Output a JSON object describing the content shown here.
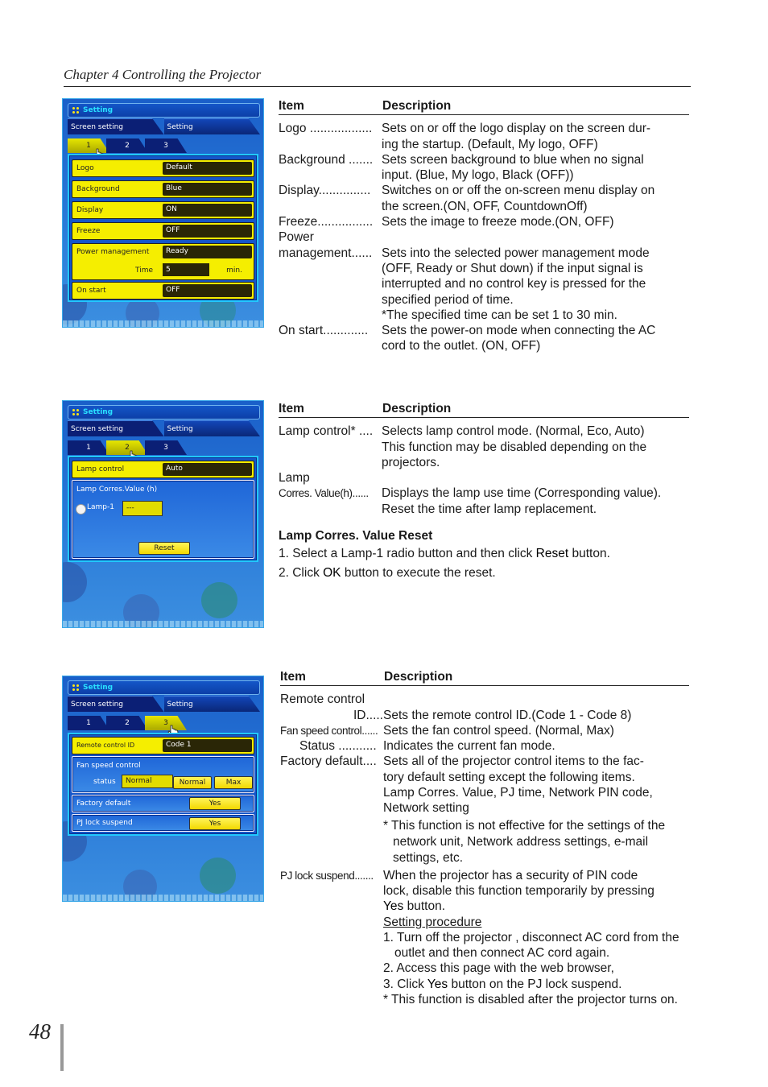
{
  "header": {
    "chapter": "Chapter 4 Controlling the Projector"
  },
  "footer": {
    "page_number": "48"
  },
  "panels": [
    {
      "title": "Setting",
      "main_tabs": [
        "Screen setting",
        "Setting"
      ],
      "sub_tabs": [
        "1",
        "2",
        "3"
      ],
      "active_sub_tab": "1",
      "rows": [
        {
          "label": "Logo",
          "value": "Default"
        },
        {
          "label": "Background",
          "value": "Blue"
        },
        {
          "label": "Display",
          "value": "ON"
        },
        {
          "label": "Freeze",
          "value": "OFF"
        },
        {
          "label": "Power management",
          "value": "Ready"
        },
        {
          "label": "On start",
          "value": "OFF"
        }
      ],
      "time_label": "Time",
      "time_value": "5",
      "time_unit": "min."
    },
    {
      "title": "Setting",
      "main_tabs": [
        "Screen setting",
        "Setting"
      ],
      "sub_tabs": [
        "1",
        "2",
        "3"
      ],
      "active_sub_tab": "2",
      "lamp_control_label": "Lamp control",
      "lamp_control_value": "Auto",
      "lamp_corres_label": "Lamp Corres.Value (h)",
      "lamp1_label": "Lamp-1",
      "lamp1_value": "---",
      "reset_label": "Reset"
    },
    {
      "title": "Setting",
      "main_tabs": [
        "Screen setting",
        "Setting"
      ],
      "sub_tabs": [
        "1",
        "2",
        "3"
      ],
      "active_sub_tab": "3",
      "remote_id_label": "Remote control ID",
      "remote_id_value": "Code 1",
      "fan_label": "Fan speed control",
      "fan_status_label": "status",
      "fan_status_value": "Normal",
      "fan_options": [
        "Normal",
        "Max"
      ],
      "factory_label": "Factory default",
      "factory_btn": "Yes",
      "pjlock_label": "PJ lock suspend",
      "pjlock_btn": "Yes"
    }
  ],
  "tables": {
    "col_item": "Item",
    "col_desc": "Description",
    "table1": [
      {
        "term": "Logo",
        "dots": " ..................",
        "lines": [
          "Sets on or off the logo display on the screen dur-",
          "ing the startup. (Default, My logo, OFF)"
        ]
      },
      {
        "term": "Background",
        "dots": " .......",
        "lines": [
          "Sets screen background to blue when no signal",
          "input. (Blue, My logo, Black (OFF))"
        ]
      },
      {
        "term": "Display",
        "dots": "...............",
        "lines": [
          "Switches on or off the on-screen menu display on",
          "the screen.(ON, OFF, CountdownOff)"
        ]
      },
      {
        "term": "Freeze",
        "dots": "................",
        "lines": [
          "Sets the image to freeze mode.(ON, OFF)"
        ]
      },
      {
        "term": "Power",
        "dots": "",
        "lines": []
      },
      {
        "term": "management",
        "dots": "......",
        "lines": [
          "Sets into the selected power management mode",
          "(OFF, Ready or Shut down) if the input signal is",
          "interrupted and no control key is pressed for the",
          "specified period of time.",
          "*The specified time can be set 1 to 30 min."
        ]
      },
      {
        "term": "On start",
        "dots": ".............",
        "lines": [
          "Sets the power-on mode when connecting the AC",
          "cord to the outlet. (ON, OFF)"
        ]
      }
    ],
    "table2": [
      {
        "term": "Lamp control*",
        "dots": " ....",
        "lines": [
          "Selects lamp control mode. (Normal, Eco, Auto)",
          "This function may be disabled depending on the",
          "projectors."
        ]
      },
      {
        "term": "Lamp",
        "dots": "",
        "lines": []
      },
      {
        "term": "Corres. Value(h)",
        "dots": "......",
        "lines": [
          "Displays the lamp use time (Corresponding value).",
          "Reset the time after lamp replacement."
        ]
      }
    ],
    "reset_section": {
      "title": "Lamp Corres. Value Reset",
      "step1_pre": "1. Select a Lamp-1 radio button and then click ",
      "step1_key": "Reset",
      "step1_post": " button.",
      "step2_pre": "2. Click ",
      "step2_key": "OK",
      "step2_post": " button to execute the reset."
    },
    "table3": {
      "remote_term1": "Remote control",
      "remote_term2": "ID",
      "remote_dots": ".....",
      "remote_def": "Sets the remote control ID.(Code 1 - Code 8)",
      "fan_term": "Fan speed control",
      "fan_dots": "......",
      "fan_def": "Sets the fan control speed. (Normal, Max)",
      "status_term": "Status",
      "status_dots": " ...........",
      "status_def": "Indicates the current fan mode.",
      "factory_term": "Factory default",
      "factory_dots": "....",
      "factory_lines": [
        "Sets all of the projector control items to the fac-",
        "tory default setting except the following items.",
        "Lamp Corres. Value, PJ time, Network PIN code,",
        "Network setting"
      ],
      "factory_note": "* This function is not effective for the settings of the network unit, Network address settings, e-mail settings, etc.",
      "pjlock_term": "PJ lock suspend",
      "pjlock_dots": ".......",
      "pjlock_lines": [
        "When the projector has a security of PIN code",
        "lock, disable this function temporarily by pressing"
      ],
      "pjlock_yes": "Yes",
      "pjlock_yes_post": " button.",
      "procedure_title": "Setting procedure",
      "proc1": "1. Turn off the projector , disconnect AC cord from the outlet and then connect AC cord again.",
      "proc2": "2. Access this page with the web browser,",
      "proc3_pre": "3. Click ",
      "proc3_key": "Yes",
      "proc3_post": " button on the PJ lock suspend.",
      "proc_note": "* This function is disabled after the projector turns on."
    }
  }
}
